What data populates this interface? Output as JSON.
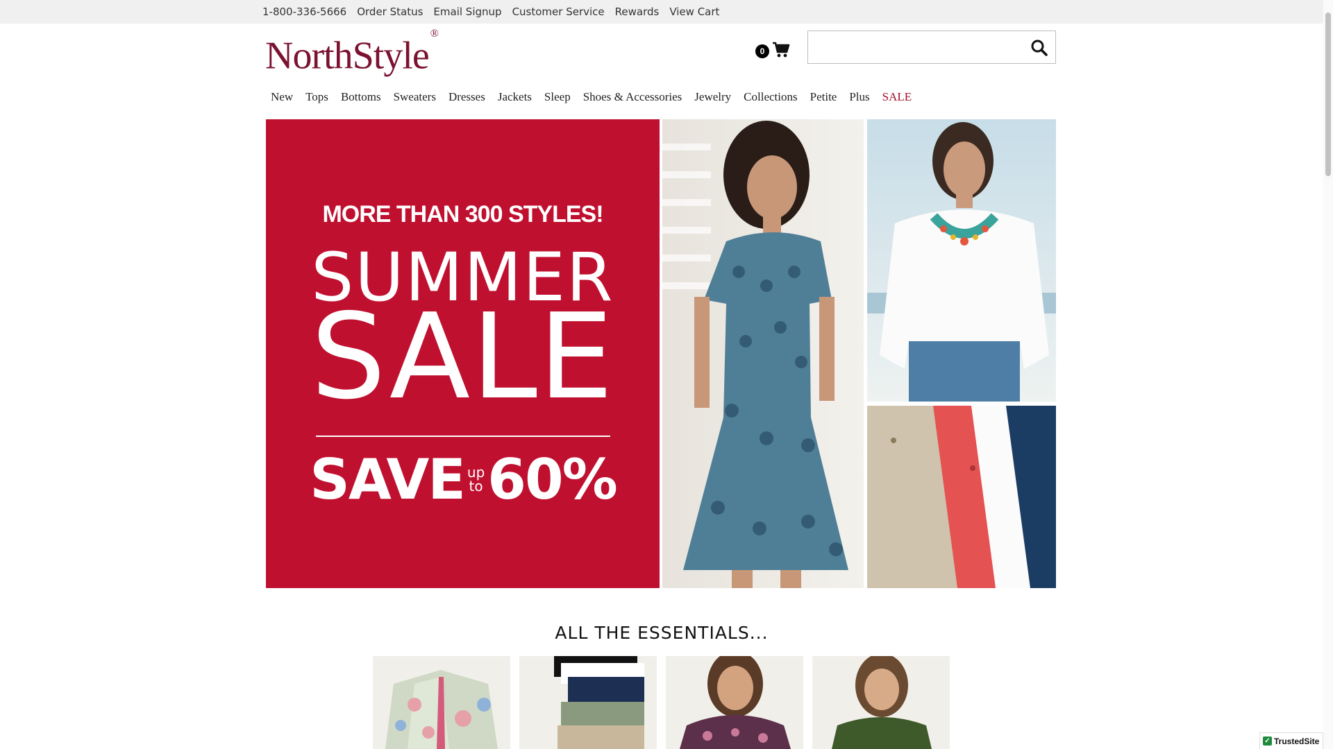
{
  "topbar": {
    "links": [
      "1-800-336-5666",
      "Order Status",
      "Email Signup",
      "Customer Service",
      "Rewards",
      "View Cart"
    ]
  },
  "brand": {
    "name": "NorthStyle",
    "mark": "®"
  },
  "cart": {
    "count": "0",
    "icon": "cart-icon"
  },
  "search": {
    "value": "",
    "placeholder": "",
    "icon": "search-icon"
  },
  "nav": {
    "items": [
      "New",
      "Tops",
      "Bottoms",
      "Sweaters",
      "Dresses",
      "Jackets",
      "Sleep",
      "Shoes & Accessories",
      "Jewelry",
      "Collections",
      "Petite",
      "Plus",
      "SALE"
    ]
  },
  "hero": {
    "kicker": "MORE THAN 300 STYLES!",
    "line1": "SUMMER",
    "line2": "SALE",
    "save": "SAVE",
    "up": "up",
    "to": "to",
    "percent": "60%",
    "colors": {
      "banner": "#c0102f",
      "sale_link": "#a0102a",
      "logo": "#7b1230"
    }
  },
  "essentials": {
    "title": "ALL THE ESSENTIALS..."
  },
  "trusted": {
    "label": "TrustedSite"
  }
}
